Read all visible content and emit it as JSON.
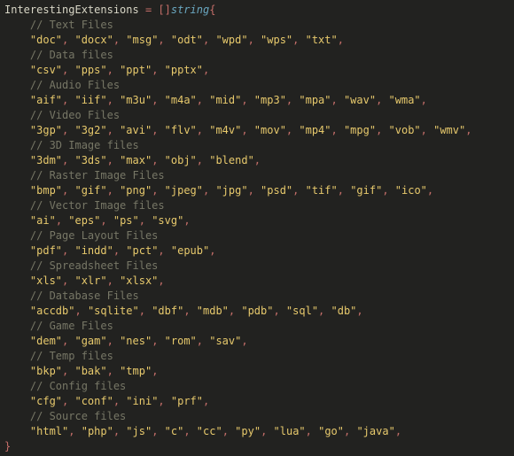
{
  "decl": {
    "var_name": "InterestingExtensions",
    "eq": " = ",
    "open_bracket": "[]",
    "type_keyword": "string",
    "open_brace": "{",
    "close_brace": "}",
    "sep": ", "
  },
  "groups": [
    {
      "comment": "// Text Files",
      "items": [
        "doc",
        "docx",
        "msg",
        "odt",
        "wpd",
        "wps",
        "txt"
      ]
    },
    {
      "comment": "// Data files",
      "items": [
        "csv",
        "pps",
        "ppt",
        "pptx"
      ]
    },
    {
      "comment": "// Audio Files",
      "items": [
        "aif",
        "iif",
        "m3u",
        "m4a",
        "mid",
        "mp3",
        "mpa",
        "wav",
        "wma"
      ]
    },
    {
      "comment": "// Video Files",
      "items": [
        "3gp",
        "3g2",
        "avi",
        "flv",
        "m4v",
        "mov",
        "mp4",
        "mpg",
        "vob",
        "wmv"
      ]
    },
    {
      "comment": "// 3D Image files",
      "items": [
        "3dm",
        "3ds",
        "max",
        "obj",
        "blend"
      ]
    },
    {
      "comment": "// Raster Image Files",
      "items": [
        "bmp",
        "gif",
        "png",
        "jpeg",
        "jpg",
        "psd",
        "tif",
        "gif",
        "ico"
      ]
    },
    {
      "comment": "// Vector Image files",
      "items": [
        "ai",
        "eps",
        "ps",
        "svg"
      ]
    },
    {
      "comment": "// Page Layout Files",
      "items": [
        "pdf",
        "indd",
        "pct",
        "epub"
      ]
    },
    {
      "comment": "// Spreadsheet Files",
      "items": [
        "xls",
        "xlr",
        "xlsx"
      ]
    },
    {
      "comment": "// Database Files",
      "items": [
        "accdb",
        "sqlite",
        "dbf",
        "mdb",
        "pdb",
        "sql",
        "db"
      ]
    },
    {
      "comment": "// Game Files",
      "items": [
        "dem",
        "gam",
        "nes",
        "rom",
        "sav"
      ]
    },
    {
      "comment": "// Temp files",
      "items": [
        "bkp",
        "bak",
        "tmp"
      ]
    },
    {
      "comment": "// Config files",
      "items": [
        "cfg",
        "conf",
        "ini",
        "prf"
      ]
    },
    {
      "comment": "// Source files",
      "items": [
        "html",
        "php",
        "js",
        "c",
        "cc",
        "py",
        "lua",
        "go",
        "java"
      ]
    }
  ]
}
